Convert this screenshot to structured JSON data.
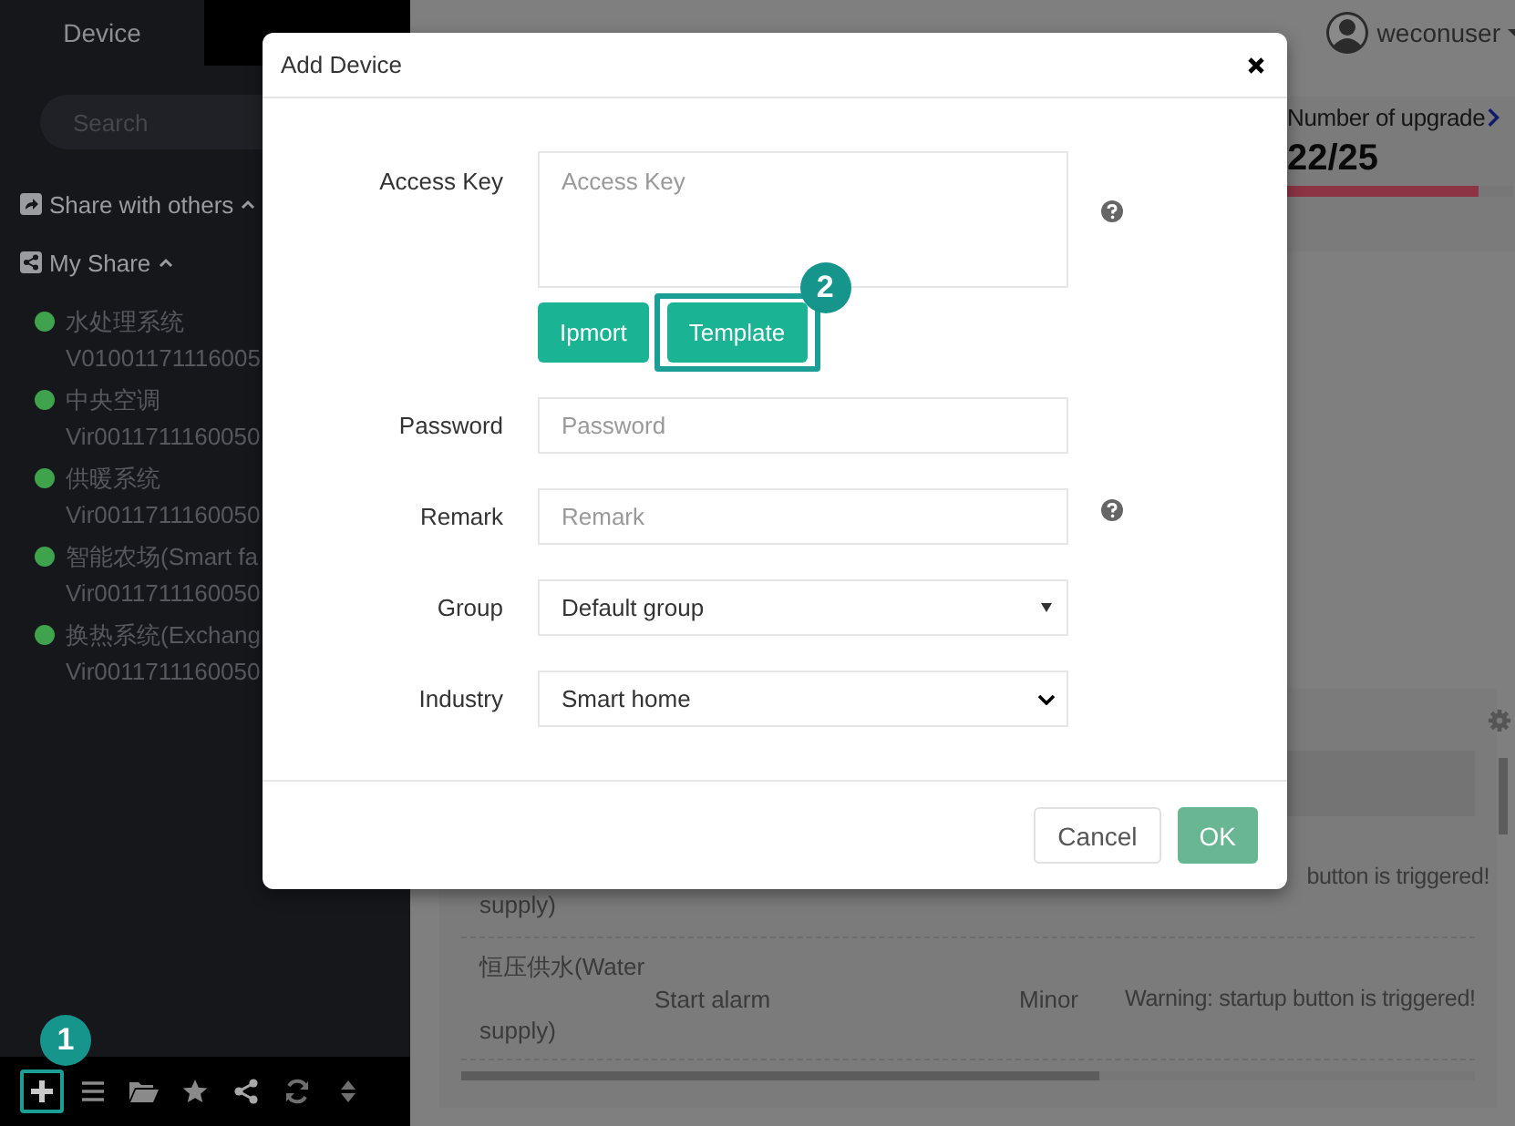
{
  "sidebar": {
    "tabs": [
      {
        "label": "Device",
        "selected": true
      }
    ],
    "search": {
      "placeholder": "Search"
    },
    "sections": [
      {
        "label": "Share with others",
        "expanded": true
      },
      {
        "label": "My Share",
        "expanded": true,
        "devices": [
          {
            "name": "水处理系统",
            "id": "V01001171116005",
            "online": true
          },
          {
            "name": "中央空调",
            "id": "Vir0011711160050",
            "online": true
          },
          {
            "name": "供暖系统",
            "id": "Vir0011711160050",
            "online": true
          },
          {
            "name": "智能农场(Smart fa",
            "id": "Vir0011711160050",
            "online": true
          },
          {
            "name": "换热系统(Exchang",
            "id": "Vir0011711160050",
            "online": true
          }
        ]
      }
    ],
    "toolbar": [
      {
        "highlighted": true,
        "callout": "1"
      },
      {
        "highlighted": false
      },
      {
        "highlighted": false
      },
      {
        "highlighted": false
      },
      {
        "highlighted": false
      },
      {
        "highlighted": false
      },
      {
        "highlighted": false
      }
    ]
  },
  "topbar": {
    "user": "weconuser"
  },
  "stat": {
    "label": "Number of upgrade",
    "value": "22/25",
    "level": 0.85
  },
  "table": {
    "rows": [
      {
        "name_lines": [
          "supply)"
        ],
        "message": "button is triggered!"
      },
      {
        "name_lines": [
          "恒压供水(Water",
          "supply)"
        ],
        "event": "Start alarm",
        "level_text": "Minor",
        "message": "Warning: startup button is triggered!"
      }
    ]
  },
  "dialog": {
    "title": "Add Device",
    "fields": [
      {
        "kind": "textarea",
        "label": "Access Key",
        "placeholder": "Access Key",
        "help": true,
        "buttons": [
          {
            "label": "Ipmort",
            "highlighted": false
          },
          {
            "label": "Template",
            "highlighted": true,
            "callout": "2"
          }
        ]
      },
      {
        "kind": "input",
        "label": "Password",
        "placeholder": "Password",
        "help": false
      },
      {
        "kind": "input",
        "label": "Remark",
        "placeholder": "Remark",
        "help": true
      },
      {
        "kind": "dropdown",
        "label": "Group",
        "value": "Default group",
        "help": false
      },
      {
        "kind": "select",
        "label": "Industry",
        "value": "Smart home",
        "help": false
      }
    ],
    "cancel": "Cancel",
    "ok": "OK"
  }
}
